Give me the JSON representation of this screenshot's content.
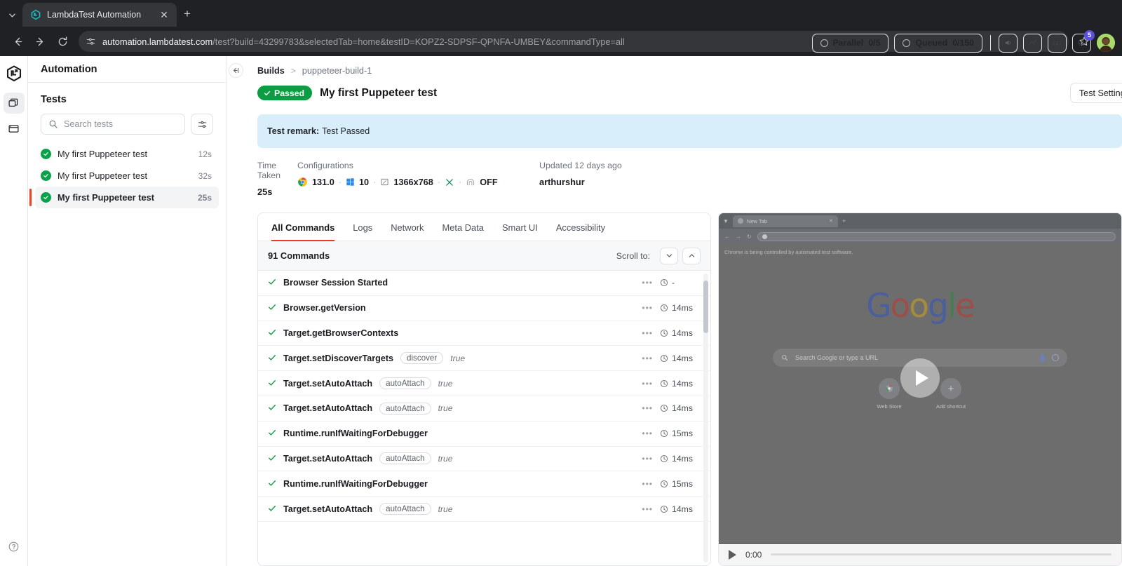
{
  "browser": {
    "tab_title": "LambdaTest Automation",
    "tab_favicon_icon": "lambdatest-icon",
    "tab_close_icon": "close-icon",
    "new_tab_icon": "plus-icon",
    "tab_list_icon": "chevron-down-icon",
    "back_icon": "arrow-left-icon",
    "forward_icon": "arrow-right-icon",
    "reload_icon": "reload-icon",
    "site_settings_icon": "site-settings-icon",
    "url_host": "automation.lambdatest.com",
    "url_path": "/test?build=43299783&selectedTab=home&testID=KOPZ2-SDPSF-QPNFA-UMBEY&commandType=all",
    "bookmark_icon": "star-icon",
    "extensions_icon": "extensions-icon"
  },
  "rail": {
    "logo_icon": "lambdatest-logo-icon",
    "items": [
      {
        "icon": "layers-icon",
        "name": "automation",
        "active": true
      },
      {
        "icon": "window-icon",
        "name": "real-time",
        "active": false
      }
    ],
    "help_icon": "help-circle-icon"
  },
  "header": {
    "app_title": "Automation",
    "parallel_label": "Parallel",
    "parallel_value": "0/5",
    "queued_label": "Queued",
    "queued_value": "0/150",
    "icons": [
      "sound-icon",
      "analytics-icon",
      "integrations-icon",
      "announcement-icon"
    ],
    "notification_badge": "5",
    "avatar_icon": "user-avatar"
  },
  "tests_panel": {
    "heading": "Tests",
    "search_placeholder": "Search tests",
    "search_value": "",
    "search_icon": "search-icon",
    "filter_icon": "filter-icon",
    "items": [
      {
        "name": "My first Puppeteer test",
        "duration": "12s",
        "status": "passed",
        "active": false
      },
      {
        "name": "My first Puppeteer test",
        "duration": "32s",
        "status": "passed",
        "active": false
      },
      {
        "name": "My first Puppeteer test",
        "duration": "25s",
        "status": "passed",
        "active": true
      }
    ]
  },
  "main": {
    "collapse_icon": "collapse-panel-icon",
    "breadcrumb": {
      "root": "Builds",
      "separator": ">",
      "current": "puppeteer-build-1"
    },
    "status_badge": "Passed",
    "status_badge_icon": "check-icon",
    "status_color": "#0a9d42",
    "title": "My first Puppeteer test",
    "test_settings_label": "Test Settings",
    "remark_label": "Test remark:",
    "remark_value": "Test Passed",
    "meta": {
      "time_taken_label": "Time Taken",
      "time_taken_value": "25s",
      "configurations_label": "Configurations",
      "browser_icon": "chrome-icon",
      "browser_version": "131.0",
      "os_icon": "windows-icon",
      "os_version": "10",
      "resolution_icon": "screen-icon",
      "resolution": "1366x768",
      "network_icon": "network-throttle-icon",
      "tunnel_icon": "tunnel-icon",
      "tunnel_state": "OFF",
      "updated_label": "Updated 12 days ago",
      "updated_user": "arthurshur"
    }
  },
  "commands_panel": {
    "tabs": [
      {
        "label": "All Commands",
        "active": true
      },
      {
        "label": "Logs",
        "active": false
      },
      {
        "label": "Network",
        "active": false
      },
      {
        "label": "Meta Data",
        "active": false
      },
      {
        "label": "Smart UI",
        "active": false
      },
      {
        "label": "Accessibility",
        "active": false
      }
    ],
    "count_label": "91 Commands",
    "scroll_to_label": "Scroll to:",
    "scroll_down_icon": "chevron-down-icon",
    "scroll_up_icon": "chevron-up-icon",
    "rows": [
      {
        "status": "passed",
        "name": "Browser Session Started",
        "arg": "",
        "argval": "",
        "dots": "•••",
        "time_icon": "clock-icon",
        "time": "-"
      },
      {
        "status": "passed",
        "name": "Browser.getVersion",
        "arg": "",
        "argval": "",
        "dots": "•••",
        "time_icon": "clock-icon",
        "time": "14ms"
      },
      {
        "status": "passed",
        "name": "Target.getBrowserContexts",
        "arg": "",
        "argval": "",
        "dots": "•••",
        "time_icon": "clock-icon",
        "time": "14ms"
      },
      {
        "status": "passed",
        "name": "Target.setDiscoverTargets",
        "arg": "discover",
        "argval": "true",
        "dots": "•••",
        "time_icon": "clock-icon",
        "time": "14ms"
      },
      {
        "status": "passed",
        "name": "Target.setAutoAttach",
        "arg": "autoAttach",
        "argval": "true",
        "dots": "•••",
        "time_icon": "clock-icon",
        "time": "14ms"
      },
      {
        "status": "passed",
        "name": "Target.setAutoAttach",
        "arg": "autoAttach",
        "argval": "true",
        "dots": "•••",
        "time_icon": "clock-icon",
        "time": "14ms"
      },
      {
        "status": "passed",
        "name": "Runtime.runIfWaitingForDebugger",
        "arg": "",
        "argval": "",
        "dots": "•••",
        "time_icon": "clock-icon",
        "time": "15ms"
      },
      {
        "status": "passed",
        "name": "Target.setAutoAttach",
        "arg": "autoAttach",
        "argval": "true",
        "dots": "•••",
        "time_icon": "clock-icon",
        "time": "14ms"
      },
      {
        "status": "passed",
        "name": "Runtime.runIfWaitingForDebugger",
        "arg": "",
        "argval": "",
        "dots": "•••",
        "time_icon": "clock-icon",
        "time": "15ms"
      },
      {
        "status": "passed",
        "name": "Target.setAutoAttach",
        "arg": "autoAttach",
        "argval": "true",
        "dots": "•••",
        "time_icon": "clock-icon",
        "time": "14ms"
      }
    ]
  },
  "video_panel": {
    "inner_tab_label": "New Tab",
    "inner_notice": "Chrome is being controlled by automated test software.",
    "google_logo": "Google",
    "search_placeholder": "Search Google or type a URL",
    "shortcuts": [
      {
        "label": "Web Store",
        "icon": "chrome-webstore-icon"
      },
      {
        "label": "Add shortcut",
        "icon": "plus-icon"
      }
    ],
    "play_overlay_icon": "play-icon",
    "controls": {
      "play_icon": "play-icon",
      "current_time": "0:00"
    }
  }
}
